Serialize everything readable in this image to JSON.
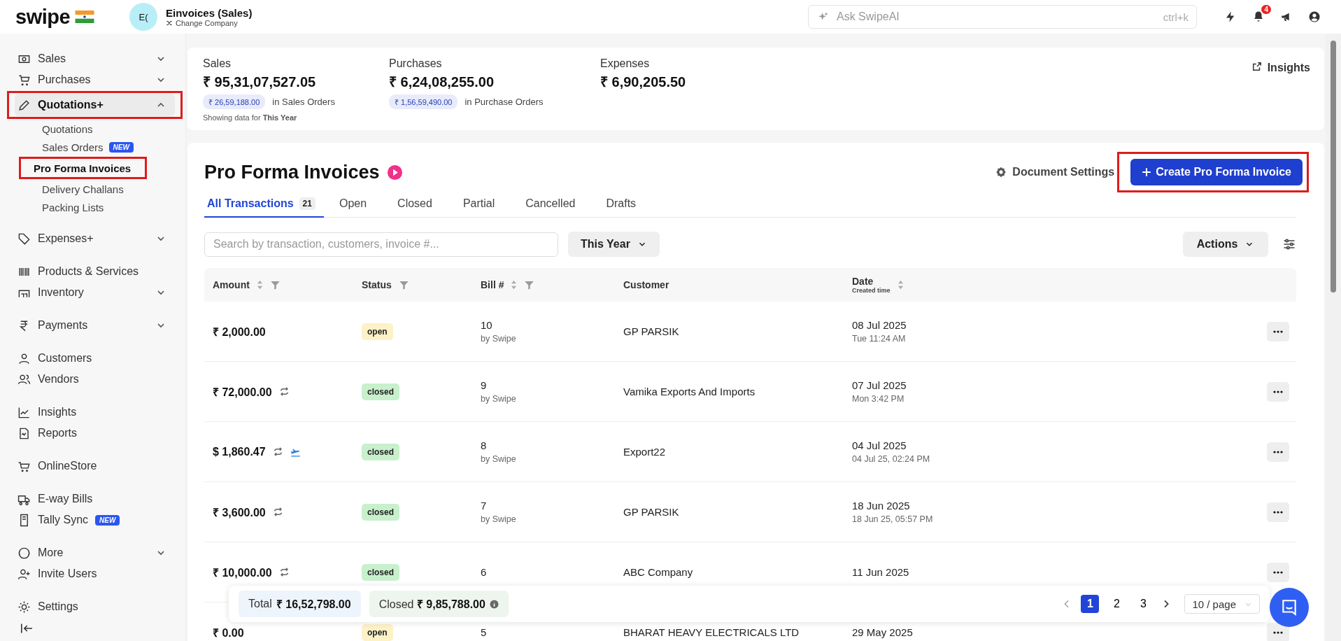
{
  "topbar": {
    "logo": "swipe",
    "company": {
      "avatar": "E(",
      "name": "Einvoices (Sales)",
      "action": "Change Company"
    },
    "search": {
      "placeholder": "Ask SwipeAI",
      "shortcut": "ctrl+k"
    },
    "notifications": "4"
  },
  "sidebar": {
    "groups": [
      [
        {
          "label": "Sales",
          "selected": false,
          "expanded": false
        },
        {
          "label": "Purchases",
          "selected": false,
          "expanded": false
        },
        {
          "label": "Quotations+",
          "selected": true,
          "expanded": true,
          "annotated": true,
          "children": [
            {
              "label": "Quotations",
              "selected": false
            },
            {
              "label": "Sales Orders",
              "selected": false,
              "badge": "NEW"
            },
            {
              "label": "Pro Forma Invoices",
              "selected": true,
              "annotated": true
            },
            {
              "label": "Delivery Challans",
              "selected": false
            },
            {
              "label": "Packing Lists",
              "selected": false
            }
          ]
        }
      ],
      [
        {
          "label": "Expenses+",
          "selected": false,
          "expanded": false
        }
      ],
      [
        {
          "label": "Products & Services",
          "selected": false
        },
        {
          "label": "Inventory",
          "selected": false,
          "expanded": false
        }
      ],
      [
        {
          "label": "Payments",
          "selected": false,
          "expanded": false
        }
      ],
      [
        {
          "label": "Customers",
          "selected": false
        },
        {
          "label": "Vendors",
          "selected": false
        }
      ],
      [
        {
          "label": "Insights",
          "selected": false
        },
        {
          "label": "Reports",
          "selected": false
        }
      ],
      [
        {
          "label": "OnlineStore",
          "selected": false
        }
      ],
      [
        {
          "label": "E-way Bills",
          "selected": false
        },
        {
          "label": "Tally Sync",
          "selected": false,
          "badge": "NEW"
        }
      ],
      [
        {
          "label": "More",
          "selected": false,
          "expanded": false
        },
        {
          "label": "Invite Users",
          "selected": false
        }
      ],
      [
        {
          "label": "Settings",
          "selected": false
        }
      ]
    ]
  },
  "summary": {
    "stats": [
      {
        "label": "Sales",
        "value": "₹ 95,31,07,527.05",
        "pill": "₹ 26,59,188.00",
        "note": "in Sales Orders"
      },
      {
        "label": "Purchases",
        "value": "₹ 6,24,08,255.00",
        "pill": "₹ 1,56,59,490.00",
        "note": "in Purchase Orders"
      },
      {
        "label": "Expenses",
        "value": "₹ 6,90,205.50"
      }
    ],
    "period_prefix": "Showing data for",
    "period": "This Year",
    "link": "Insights"
  },
  "page": {
    "title": "Pro Forma Invoices",
    "settings": "Document Settings",
    "create_button": {
      "label": "Create Pro Forma Invoice",
      "annotated": true
    },
    "tabs": [
      {
        "label": "All Transactions",
        "count": "21",
        "selected": true
      },
      {
        "label": "Open",
        "selected": false
      },
      {
        "label": "Closed",
        "selected": false
      },
      {
        "label": "Partial",
        "selected": false
      },
      {
        "label": "Cancelled",
        "selected": false
      },
      {
        "label": "Drafts",
        "selected": false
      }
    ],
    "search": {
      "placeholder": "Search by transaction, customers, invoice #..."
    },
    "period": "This Year",
    "actions": "Actions"
  },
  "table": {
    "columns": [
      {
        "label": "Amount",
        "sortable": true,
        "filterable": true
      },
      {
        "label": "Status",
        "sortable": false,
        "filterable": true
      },
      {
        "label": "Bill #",
        "sortable": true,
        "filterable": true
      },
      {
        "label": "Customer",
        "sortable": false,
        "filterable": false
      },
      {
        "label": "Date",
        "sub": "Created time",
        "sortable": true,
        "filterable": false
      }
    ],
    "rows": [
      {
        "amount": "₹ 2,000.00",
        "recurring": false,
        "exported": false,
        "status": "open",
        "color": "#fdf1c7",
        "bill": "10",
        "by": "by Swipe",
        "customer": "GP PARSIK",
        "date": "08 Jul 2025",
        "time": "Tue 11:24 AM"
      },
      {
        "amount": "₹ 72,000.00",
        "recurring": true,
        "exported": false,
        "status": "closed",
        "color": "#c8f0cc",
        "bill": "9",
        "by": "by Swipe",
        "customer": "Vamika Exports And Imports",
        "date": "07 Jul 2025",
        "time": "Mon 3:42 PM"
      },
      {
        "amount": "$ 1,860.47",
        "recurring": true,
        "exported": true,
        "status": "closed",
        "color": "#c8f0cc",
        "bill": "8",
        "by": "by Swipe",
        "customer": "Export22",
        "date": "04 Jul 2025",
        "time": "04 Jul 25, 02:24 PM"
      },
      {
        "amount": "₹ 3,600.00",
        "recurring": true,
        "exported": false,
        "status": "closed",
        "color": "#c8f0cc",
        "bill": "7",
        "by": "by Swipe",
        "customer": "GP PARSIK",
        "date": "18 Jun 2025",
        "time": "18 Jun 25, 05:57 PM"
      },
      {
        "amount": "₹ 10,000.00",
        "recurring": true,
        "exported": false,
        "status": "closed",
        "color": "#c8f0cc",
        "bill": "6",
        "customer": "ABC Company",
        "date": "11 Jun 2025"
      },
      {
        "amount": "₹ 0.00",
        "recurring": false,
        "exported": false,
        "status": "open",
        "color": "#fdf1c7",
        "bill": "5",
        "customer": "BHARAT HEAVY ELECTRICALS LTD",
        "date": "29 May 2025"
      }
    ]
  },
  "footer": {
    "total_label": "Total",
    "total": "₹ 16,52,798.00",
    "closed_label": "Closed",
    "closed": "₹ 9,85,788.00",
    "pages": [
      {
        "label": "1",
        "selected": true
      },
      {
        "label": "2",
        "selected": false
      },
      {
        "label": "3",
        "selected": false
      }
    ],
    "page_size": "10 / page"
  }
}
